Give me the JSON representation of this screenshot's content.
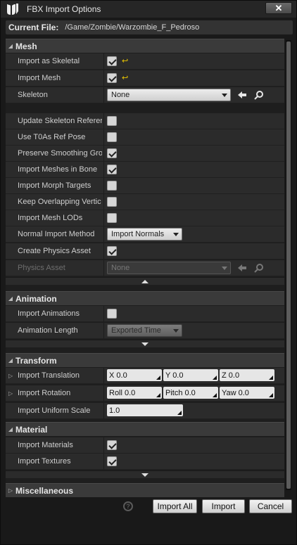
{
  "window": {
    "title": "FBX Import Options",
    "close_glyph": "✕"
  },
  "current_file": {
    "label": "Current File:",
    "value": "/Game/Zombie/Warzombie_F_Pedroso"
  },
  "mesh": {
    "header": "Mesh",
    "import_as_skeletal": {
      "label": "Import as Skeletal",
      "checked": true
    },
    "import_mesh": {
      "label": "Import Mesh",
      "checked": true
    },
    "skeleton": {
      "label": "Skeleton",
      "value": "None"
    },
    "update_skeleton": {
      "label": "Update Skeleton Referer",
      "checked": false
    },
    "use_t0": {
      "label": "Use T0As Ref Pose",
      "checked": false
    },
    "preserve_smoothing": {
      "label": "Preserve Smoothing Gro",
      "checked": true
    },
    "import_meshes_bone": {
      "label": "Import Meshes in Bone",
      "checked": true
    },
    "import_morph": {
      "label": "Import Morph Targets",
      "checked": false
    },
    "keep_overlapping": {
      "label": "Keep Overlapping Vertic",
      "checked": false
    },
    "import_lods": {
      "label": "Import Mesh LODs",
      "checked": false
    },
    "normal_method": {
      "label": "Normal Import Method",
      "value": "Import Normals"
    },
    "create_physics": {
      "label": "Create Physics Asset",
      "checked": true
    },
    "physics_asset": {
      "label": "Physics Asset",
      "value": "None"
    }
  },
  "animation": {
    "header": "Animation",
    "import_animations": {
      "label": "Import Animations",
      "checked": false
    },
    "length": {
      "label": "Animation Length",
      "value": "Exported Time"
    }
  },
  "transform": {
    "header": "Transform",
    "translation": {
      "label": "Import Translation",
      "x": "X  0.0",
      "y": "Y  0.0",
      "z": "Z  0.0"
    },
    "rotation": {
      "label": "Import Rotation",
      "roll": "Roll  0.0",
      "pitch": "Pitch  0.0",
      "yaw": "Yaw  0.0"
    },
    "scale": {
      "label": "Import Uniform Scale",
      "value": "1.0"
    }
  },
  "material": {
    "header": "Material",
    "import_materials": {
      "label": "Import Materials",
      "checked": true
    },
    "import_textures": {
      "label": "Import Textures",
      "checked": true
    }
  },
  "misc": {
    "header": "Miscellaneous"
  },
  "buttons": {
    "import_all": "Import All",
    "import": "Import",
    "cancel": "Cancel",
    "help": "?"
  }
}
